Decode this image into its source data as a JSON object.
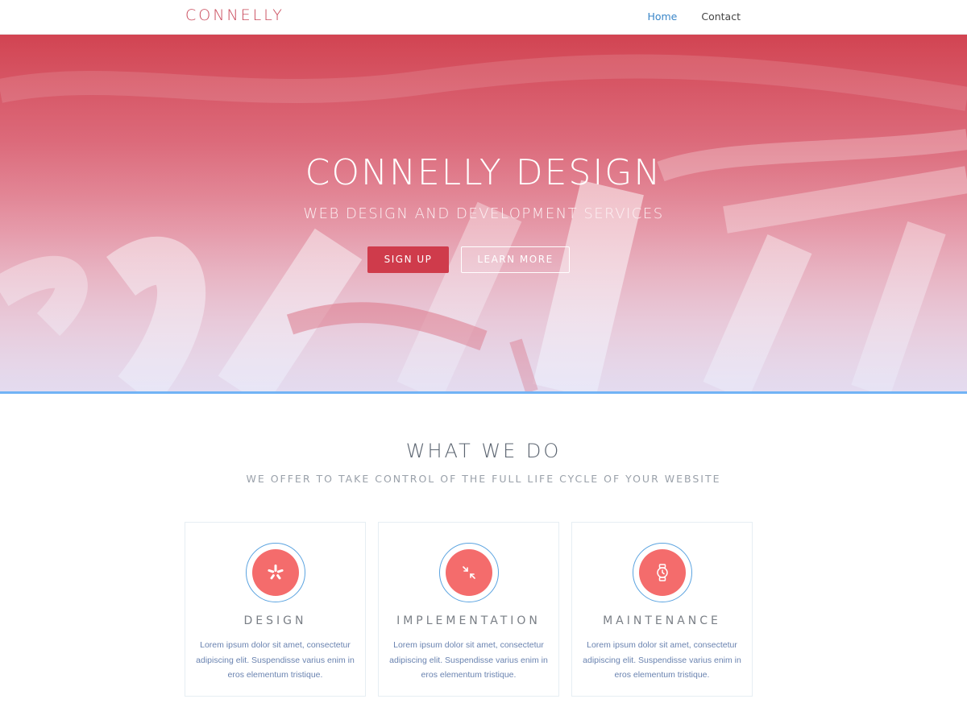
{
  "navbar": {
    "brand": "CONNELLY",
    "links": [
      {
        "label": "Home",
        "active": true
      },
      {
        "label": "Contact",
        "active": false
      }
    ]
  },
  "hero": {
    "title": "CONNELLY DESIGN",
    "subtitle": "WEB DESIGN AND DEVELOPMENT SERVICES",
    "primary_button": "SIGN UP",
    "secondary_button": "LEARN MORE"
  },
  "services": {
    "title": "WHAT WE DO",
    "subtitle": "WE OFFER TO TAKE CONTROL OF THE FULL LIFE CYCLE OF YOUR WEBSITE",
    "items": [
      {
        "title": "DESIGN",
        "icon": "yelp-icon",
        "text": "Lorem ipsum dolor sit amet, consectetur adipiscing elit. Suspendisse varius enim in eros elementum tristique."
      },
      {
        "title": "IMPLEMENTATION",
        "icon": "compress-icon",
        "text": "Lorem ipsum dolor sit amet, consectetur adipiscing elit. Suspendisse varius enim in eros elementum tristique."
      },
      {
        "title": "MAINTENANCE",
        "icon": "watch-icon",
        "text": "Lorem ipsum dolor sit amet, consectetur adipiscing elit. Suspendisse varius enim in eros elementum tristique."
      }
    ]
  },
  "colors": {
    "brand": "#c9495a",
    "primary_button": "#cf3b4b",
    "icon_fill": "#f46c6c",
    "accent_blue": "#71b3f5",
    "nav_active": "#3a86c8"
  }
}
